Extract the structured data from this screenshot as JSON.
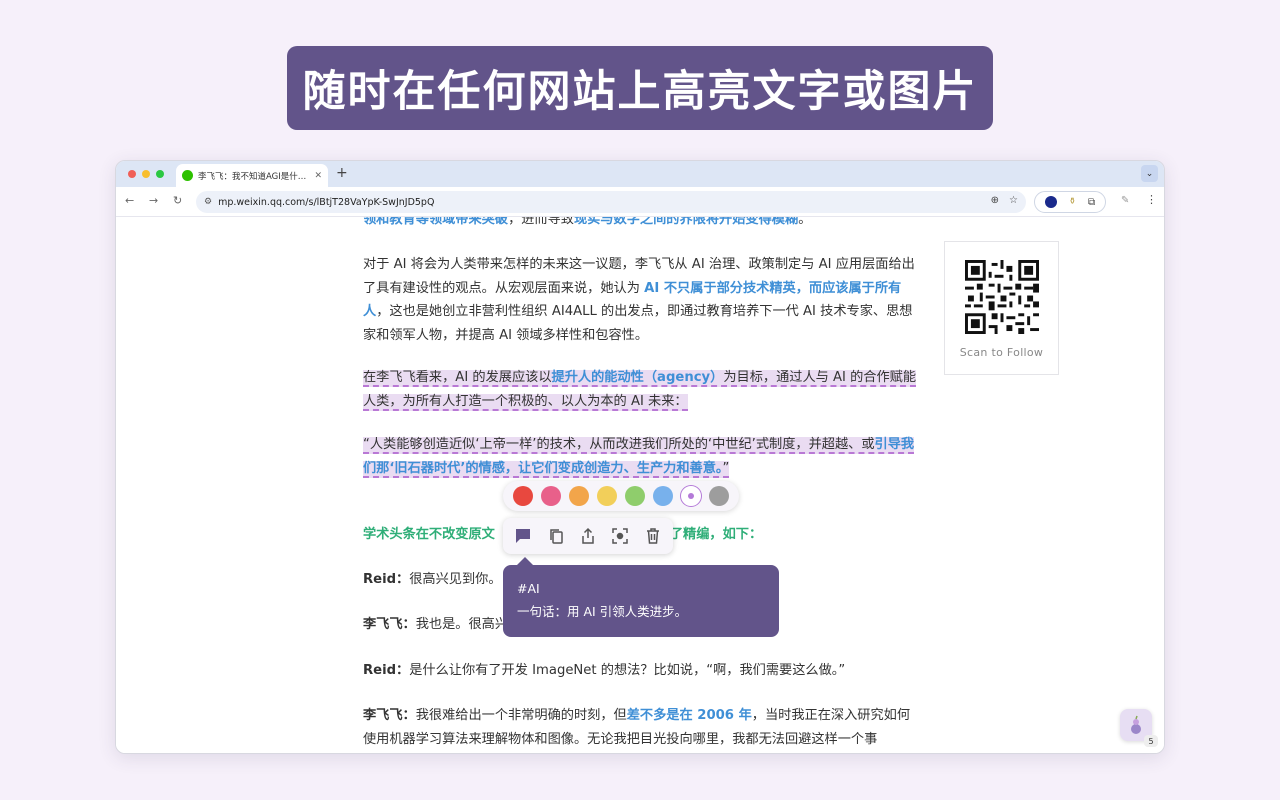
{
  "hero": {
    "title": "随时在任何网站上高亮文字或图片"
  },
  "browser": {
    "tab": {
      "title": "李飞飞：我不知道AGI是什么，"
    },
    "address": {
      "url": "mp.weixin.qq.com/s/lBtjT28VaYpK-SwJnJD5pQ"
    },
    "extensions": {
      "badge": "5"
    }
  },
  "article": {
    "p0": {
      "a": "领和教育等领域带来突破",
      "b": "，进而导致",
      "c": "现实与数字之间的界限将开始变得模糊",
      "d": "。"
    },
    "p1": {
      "a": "对于 AI 将会为人类带来怎样的未来这一议题，李飞飞从 AI 治理、政策制定与 AI 应用层面给出了具有建设性的观点。从宏观层面来说，她认为 ",
      "b": "AI 不只属于部分技术精英，而应该属于所有人",
      "c": "，这也是她创立非营利性组织 AI4ALL 的出发点，即通过教育培养下一代 AI 技术专家、思想家和领军人物，并提高 AI 领域多样性和包容性。"
    },
    "p2": {
      "a": "在李飞飞看来，AI 的发展应该以",
      "b": "提升人的能动性（agency）",
      "c": "为目标，通过人与 AI 的合作赋能人类，为所有人打造一个积极的、以人为本的 AI 未来："
    },
    "p3": {
      "a": "“人类能够创造近似‘上帝一样’的技术，从而改进我们所处的‘中世纪’式制度，并超越、或",
      "b": "引导我们那‘旧石器时代’的情感，让它们变成创造力、生产力和善意。",
      "c": "”"
    },
    "p4": {
      "a": "学术头条在不改变原文",
      "b": "了精编，如下："
    },
    "p5": {
      "speaker": "Reid：",
      "text": "很高兴见到你。"
    },
    "p6": {
      "speaker": "李飞飞：",
      "text": "我也是。很高兴"
    },
    "p7": {
      "speaker": "Reid：",
      "text": "是什么让你有了开发 ImageNet 的想法？比如说，“啊，我们需要这么做。”"
    },
    "p8": {
      "speaker": "李飞飞：",
      "a": "我很难给出一个非常明确的时刻，但",
      "b": "差不多是在 2006 年",
      "c": "，当时我正在深入研究如何使用机器学习算法来理解物体和图像。无论我把目光投向哪里，我都无法回避这样一个事"
    }
  },
  "qr": {
    "caption": "Scan to Follow"
  },
  "highlighter": {
    "colors": [
      "#e8483f",
      "#e8608a",
      "#f2a54a",
      "#f2cf5a",
      "#8fcd6c",
      "#78b1ec",
      "#ffffff",
      "#9d9d9d"
    ],
    "selected_index": 6,
    "actions": [
      "comment-icon",
      "copy-icon",
      "share-icon",
      "screenshot-icon",
      "trash-icon"
    ],
    "note": {
      "tag": "#AI",
      "text": "一句话：用 AI 引领人类进步。"
    },
    "float_badge": "5"
  }
}
